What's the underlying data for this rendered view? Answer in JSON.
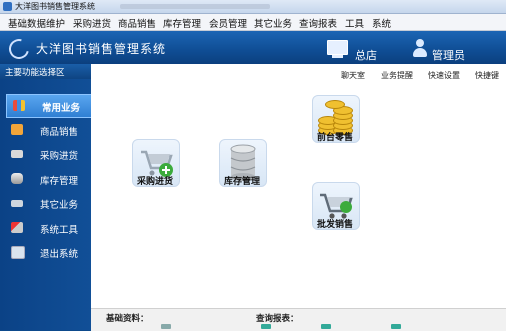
{
  "window": {
    "title": "大洋图书销售管理系统"
  },
  "menu": [
    "基础数据维护",
    "采购进货",
    "商品销售",
    "库存管理",
    "会员管理",
    "其它业务",
    "查询报表",
    "工具",
    "系统"
  ],
  "header": {
    "app_title": "大洋图书销售管理系统",
    "branch": "总店",
    "role": "管理员"
  },
  "sidebar": {
    "heading": "主要功能选择区",
    "items": [
      {
        "label": "常用业务",
        "icon": "books-icon",
        "active": true
      },
      {
        "label": "商品销售",
        "icon": "shop-icon"
      },
      {
        "label": "采购进货",
        "icon": "truck-icon"
      },
      {
        "label": "库存管理",
        "icon": "database-icon"
      },
      {
        "label": "其它业务",
        "icon": "keyboard-icon"
      },
      {
        "label": "系统工具",
        "icon": "tools-icon"
      },
      {
        "label": "退出系统",
        "icon": "exit-icon"
      }
    ]
  },
  "toplinks": [
    "聊天室",
    "业务提醒",
    "快速设置",
    "快捷键"
  ],
  "tiles": [
    {
      "label": "前台零售",
      "icon": "coins-icon"
    },
    {
      "label": "采购进货",
      "icon": "cart-add-icon"
    },
    {
      "label": "库存管理",
      "icon": "database-icon"
    },
    {
      "label": "批发销售",
      "icon": "cart-icon"
    }
  ],
  "footer": {
    "basic_label": "基础资料：",
    "query_label": "查询报表："
  },
  "colors": {
    "header": "#0f4d94",
    "sidebar_active": "#3f8fde",
    "accent_gold": "#f0c030"
  }
}
